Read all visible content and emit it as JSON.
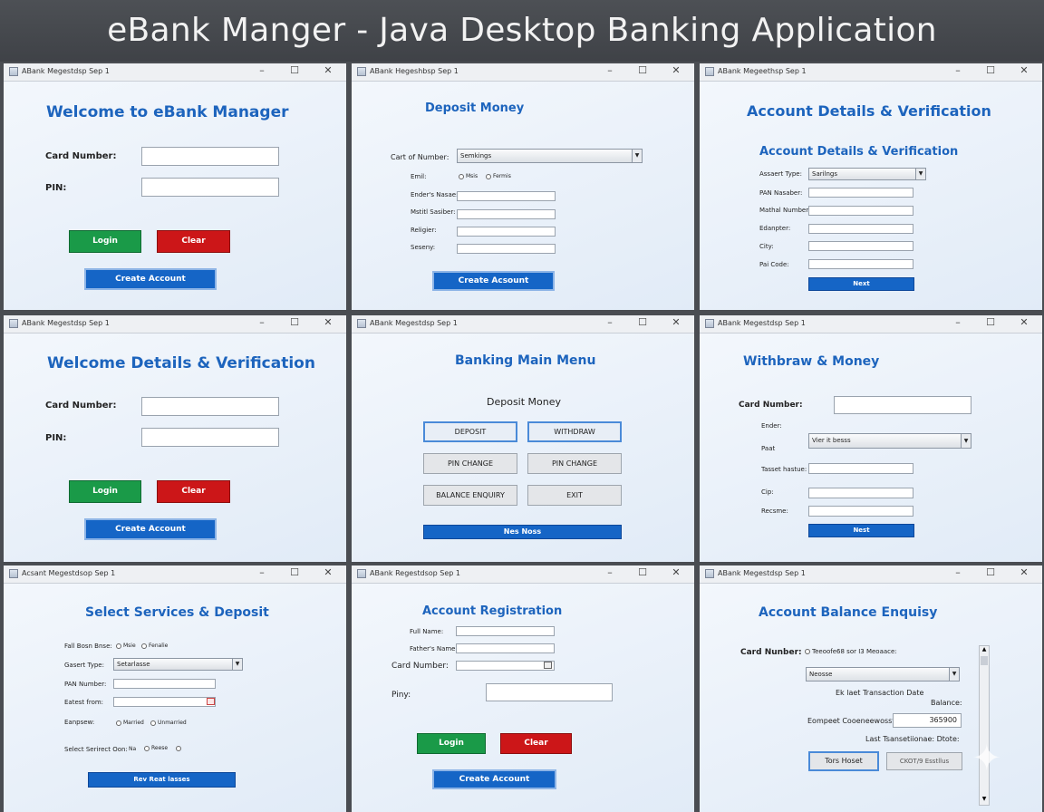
{
  "banner": "eBank Manger - Java Desktop Banking Application",
  "window_controls": {
    "minimize": "–",
    "maximize": "☐",
    "close": "✕"
  },
  "windows": {
    "w1": {
      "title": "ABank Megestdsp Sep 1",
      "heading": "Welcome to eBank Manager",
      "card_label": "Card Number:",
      "pin_label": "PIN:",
      "card_value": "",
      "pin_value": "",
      "login": "Login",
      "clear": "Clear",
      "create": "Create Account"
    },
    "w2": {
      "title": "ABank Hegeshbsp Sep 1",
      "heading": "Deposit Money",
      "account_type_label": "Cart of Number:",
      "account_type_value": "Semkings",
      "email_label": "Emil:",
      "radio_male": "Msis",
      "radio_female": "Fermis",
      "f1_label": "Ender's Nasae:",
      "f2_label": "Mstitl Sasiber:",
      "f3_label": "Religier:",
      "f4_label": "Seseny:",
      "create": "Create Acsount"
    },
    "w3": {
      "title": "ABank Megeethsp Sep 1",
      "heading": "Account Details & Verification",
      "subheading": "Account Details & Verification",
      "type_label": "Assaert Type:",
      "type_value": "Sarilngs",
      "f1_label": "PAN Nasaber:",
      "f2_label": "Mathal Number:",
      "f3_label": "Edanpter:",
      "f4_label": "City:",
      "f5_label": "Pai Code:",
      "next": "Next"
    },
    "w4": {
      "title": "ABank Megestdsp Sep 1",
      "heading": "Welcome Details & Verification",
      "card_label": "Card Number:",
      "pin_label": "PIN:",
      "login": "Login",
      "clear": "Clear",
      "create": "Create Account"
    },
    "w5": {
      "title": "ABank Megestdsp Sep 1",
      "heading": "Banking Main Menu",
      "subheading": "Deposit Money",
      "deposit": "DEPOSIT",
      "withdraw": "WITHDRAW",
      "pin_change_1": "PIN CHANGE",
      "pin_change_2": "PIN CHANGE",
      "balance": "BALANCE ENQUIRY",
      "exit": "EXIT",
      "bottom": "Nes Noss"
    },
    "w6": {
      "title": "ABank Megestdsp Sep 1",
      "heading": "Withbraw & Money",
      "card_label": "Card Number:",
      "f1_label": "Ender:",
      "f2_label": "Paat",
      "combo_value": "Vier it besss",
      "f3_label": "Tasset hastue:",
      "f4_label": "Cip:",
      "f5_label": "Recsme:",
      "next": "Nest"
    },
    "w7": {
      "title": "Acsant Megestdsop Sep 1",
      "heading": "Select Services & Deposit",
      "f1_label": "Fall Bosn Bnse:",
      "radio_male": "Msie",
      "radio_female": "Fenalie",
      "type_label": "Gasert Type:",
      "type_value": "Setarlasse",
      "f2_label": "PAN Number:",
      "f3_label": "Eatest from:",
      "f4_label": "Eanpsew:",
      "radio_married": "Married",
      "radio_unmarried": "Unmarried",
      "f5_label": "Select Serirect Oon:",
      "f5_opt1": "Na",
      "f5_opt2": "Reese",
      "bottom": "Rev Reat lasses"
    },
    "w8": {
      "title": "ABank Regestdsop Sep 1",
      "heading": "Account Registration",
      "f1_label": "Full Name:",
      "f2_label": "Father's Name:",
      "card_label": "Card Number:",
      "pin_label": "Piny:",
      "login": "Login",
      "clear": "Clear",
      "create": "Create Account"
    },
    "w9": {
      "title": "ABank Megestdsp Sep 1",
      "heading": "Account Balance Enquisy",
      "card_label": "Card Nunber:",
      "radio_text": "Teeoofe68 sor I3 Meoaace:",
      "combo_value": "Neosse",
      "last_txn": "Ek  laet Transaction Date",
      "balance_label": "Balance:",
      "corr_label": "Eompeet Cooeneewosst",
      "corr_value": "365900",
      "last_txn2": "Last Tsansetiionae: Dtote:",
      "btn1": "Tors Hoset",
      "btn2": "CKOT/9 Esstllus"
    }
  }
}
